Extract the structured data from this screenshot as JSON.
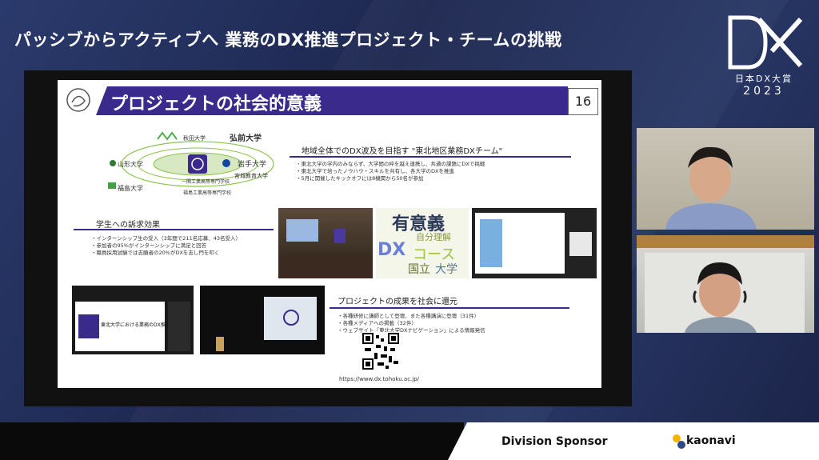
{
  "header": {
    "title": "パッシブからアクティブへ 業務のDX推進プロジェクト・チームの挑戦"
  },
  "award": {
    "line1": "日本DX大賞",
    "line2": "2023"
  },
  "slide": {
    "title": "プロジェクトの社会的意義",
    "page_number": "16",
    "universities": [
      "弘前大学",
      "秋田大学",
      "岩手大学",
      "山形大学",
      "福島大学",
      "宮城教育大学",
      "一関工業高等専門学校",
      "福島工業高等専門学校"
    ],
    "section1": {
      "heading": "地域全体でのDX波及を目指す \"東北地区業務DXチーム\"",
      "bullets": [
        "東北大学の学内のみならず、大学間の枠を越え連携し、共通の課題にDXで挑戦",
        "東北大学で培ったノウハウ・スキルを共有し、各大学のDXを推進",
        "5月に開催したキックオフには8機関から50名が参加"
      ]
    },
    "section2": {
      "heading": "学生への訴求効果",
      "bullets": [
        "インターンシップ生の受入（3年間で211名応募、43名受入）",
        "参加者の95%がインターンシップに満足と回答",
        "職員採用試験では志願者の20%がDXを志し門を叩く"
      ]
    },
    "wordcloud": {
      "words": [
        "有意義",
        "自分理解",
        "DX",
        "コース",
        "国立",
        "大学"
      ]
    },
    "section3": {
      "heading": "プロジェクトの成果を社会に還元",
      "bullets": [
        "各種研修に講師として登壇、また各種講演に登壇（31件）",
        "各種メディアへの掲載（32件）",
        "ウェブサイト「東北大学DXナビゲーション」による情報発信"
      ],
      "url": "https://www.dx.tohoku.ac.jp/"
    },
    "screen_caption": "東北大学における業務のDX推進"
  },
  "footer": {
    "sponsor_label": "Division Sponsor",
    "sponsor_name": "kaonavi"
  },
  "colors": {
    "background": "#1f2a52",
    "slide_accent": "#3a2a8c"
  }
}
